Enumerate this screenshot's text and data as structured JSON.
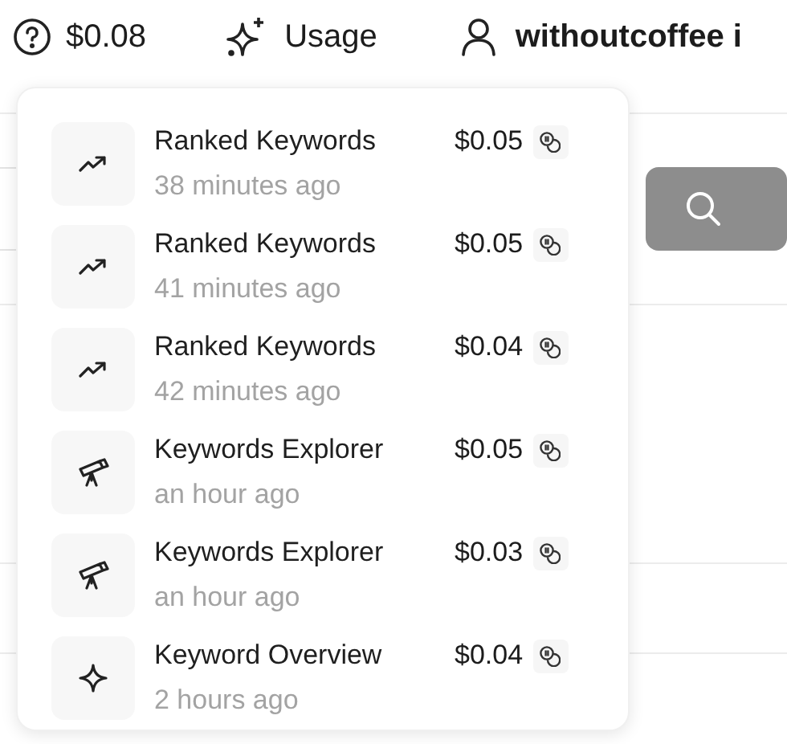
{
  "header": {
    "balance": "$0.08",
    "usage_label": "Usage",
    "user": "withoutcoffee i"
  },
  "usage_items": [
    {
      "kind": "trend",
      "title": "Ranked Keywords",
      "time": "38 minutes ago",
      "cost": "$0.05"
    },
    {
      "kind": "trend",
      "title": "Ranked Keywords",
      "time": "41 minutes ago",
      "cost": "$0.05"
    },
    {
      "kind": "trend",
      "title": "Ranked Keywords",
      "time": "42 minutes ago",
      "cost": "$0.04"
    },
    {
      "kind": "telescope",
      "title": "Keywords Explorer",
      "time": "an hour ago",
      "cost": "$0.05"
    },
    {
      "kind": "telescope",
      "title": "Keywords Explorer",
      "time": "an hour ago",
      "cost": "$0.03"
    },
    {
      "kind": "sparkle",
      "title": "Keyword Overview",
      "time": "2 hours ago",
      "cost": "$0.04"
    }
  ]
}
